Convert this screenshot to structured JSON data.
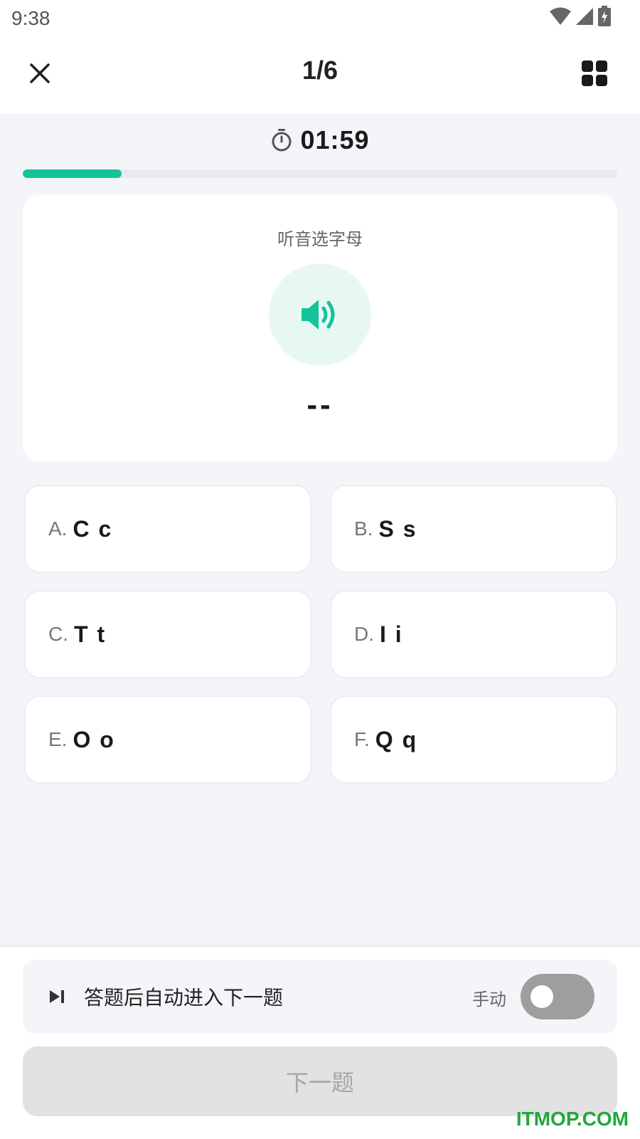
{
  "status_bar": {
    "time": "9:38"
  },
  "header": {
    "page_counter": "1/6"
  },
  "timer": {
    "value": "01:59"
  },
  "progress": {
    "fraction": 0.1667
  },
  "question": {
    "prompt": "听音选字母",
    "answer_placeholder": "--"
  },
  "options": [
    {
      "key": "A.",
      "value": "C c"
    },
    {
      "key": "B.",
      "value": "S s"
    },
    {
      "key": "C.",
      "value": "T t"
    },
    {
      "key": "D.",
      "value": "I i"
    },
    {
      "key": "E.",
      "value": "O o"
    },
    {
      "key": "F.",
      "value": "Q q"
    }
  ],
  "auto_advance": {
    "label": "答题后自动进入下一题",
    "mode_label": "手动",
    "enabled": false
  },
  "next_button": {
    "label": "下一题"
  },
  "watermark": {
    "text": "ITMOP.COM"
  },
  "colors": {
    "accent": "#13c49a",
    "toggle_off": "#9e9e9e",
    "watermark": "#1fa83a"
  },
  "icons": {
    "close": "close-icon",
    "grid": "grid-icon",
    "timer": "stopwatch-icon",
    "audio": "speaker-icon",
    "skip": "skip-next-icon"
  }
}
